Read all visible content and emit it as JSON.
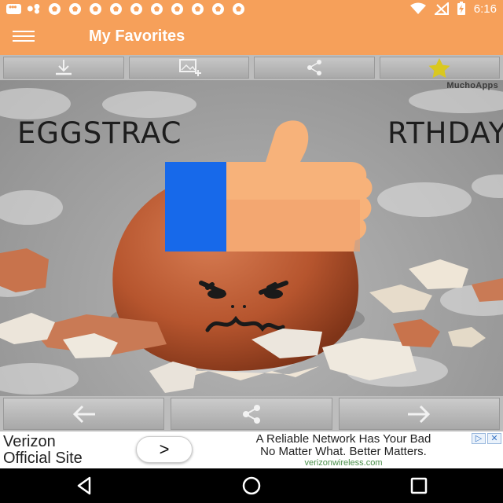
{
  "status_bar": {
    "time": "6:16",
    "icons": [
      "message-icon",
      "baseball-icon",
      "soccer-ball-icon",
      "wifi-icon",
      "no-signal-icon",
      "battery-charging-icon"
    ]
  },
  "app_bar": {
    "title": "My Favorites",
    "menu_icon": "hamburger-icon"
  },
  "toolbar": {
    "buttons": [
      {
        "icon": "download-icon"
      },
      {
        "icon": "add-image-icon"
      },
      {
        "icon": "share-icon"
      },
      {
        "icon": "star-icon"
      }
    ]
  },
  "content": {
    "watermark": "MuchoApps",
    "greeting": "EGGSTRAORDINARY BIRTHDAY!",
    "greeting_visible_left": "EGGSTRAC",
    "greeting_visible_right": "RTHDAY!",
    "overlay_icon": "thumbs-up-icon"
  },
  "bottom_nav": {
    "buttons": [
      {
        "icon": "arrow-left-icon"
      },
      {
        "icon": "share-icon"
      },
      {
        "icon": "arrow-right-icon"
      }
    ]
  },
  "ad": {
    "title": "Verizon\nOfficial Site",
    "title_line1": "Verizon",
    "title_line2": "Official Site",
    "cta": ">",
    "text_line1": "A Reliable Network Has Your Bad",
    "text_line2": "No Matter What. Better Matters.",
    "url": "verizonwireless.com",
    "badges": [
      "▷",
      "✕"
    ]
  },
  "system_nav": {
    "buttons": [
      "back-icon",
      "home-icon",
      "recents-icon"
    ]
  },
  "colors": {
    "accent": "#f6a05a",
    "thumb_skin": "#f7b27a",
    "thumb_sleeve": "#1a6ff0",
    "star": "#d9c81f"
  }
}
